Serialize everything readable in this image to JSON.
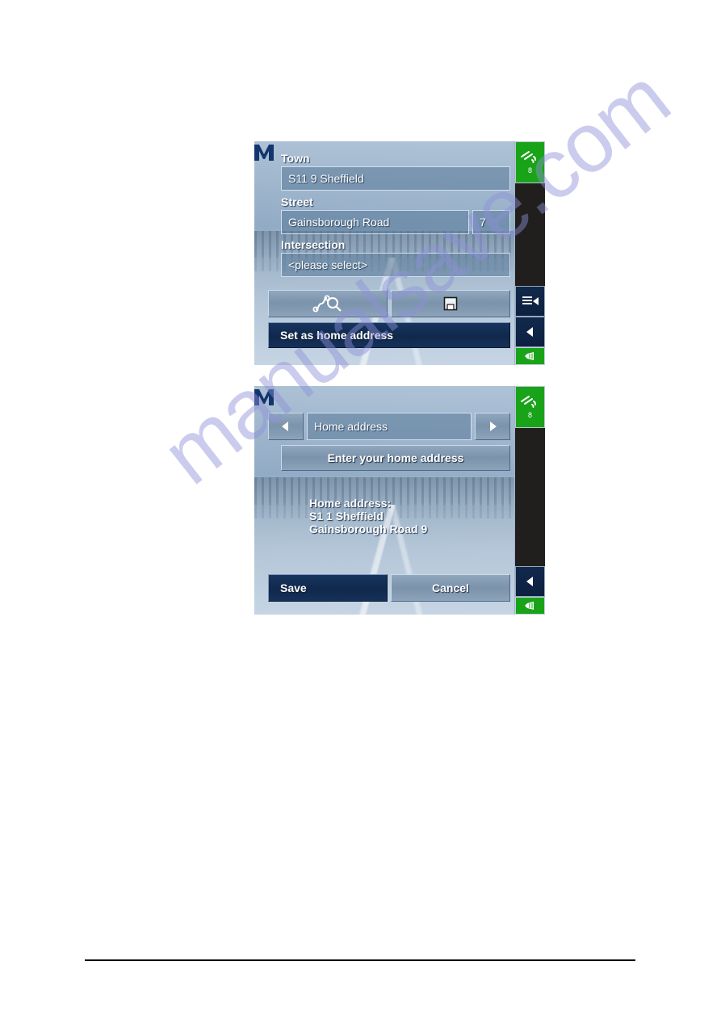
{
  "document": {
    "type": "user-manual-page",
    "watermark": "manualsave.com",
    "footer_rule": true
  },
  "panels": [
    {
      "id": "address-entry",
      "logo_icon": "m-logo-icon",
      "fields": [
        {
          "label": "Town",
          "value": "S11 9 Sheffield",
          "name": "town"
        },
        {
          "label": "Street",
          "value": "Gainsborough Road",
          "name": "street",
          "number": "7"
        },
        {
          "label": "Intersection",
          "value": "<please select>",
          "name": "intersection"
        }
      ],
      "icon_buttons": [
        {
          "icon": "route-search-icon",
          "name": "search-route-button"
        },
        {
          "icon": "floppy-save-icon",
          "name": "save-destination-button"
        }
      ],
      "primary_button": "Set as home address",
      "sidebar": {
        "gps_icon": "satellite-icon",
        "satellite_count": "8",
        "menu_icon": "menu-list-icon",
        "back_icon": "back-arrow-icon",
        "hand_icon": "hand-icon"
      }
    },
    {
      "id": "home-address-settings",
      "logo_icon": "m-logo-icon",
      "nav": {
        "prev_icon": "left-arrow-icon",
        "title": "Home address",
        "next_icon": "right-arrow-icon"
      },
      "action_button": "Enter your home address",
      "info": {
        "heading": "Home address:",
        "line1": "S1 1 Sheffield",
        "line2": "Gainsborough Road 9"
      },
      "buttons": {
        "save": "Save",
        "cancel": "Cancel"
      },
      "sidebar": {
        "gps_icon": "satellite-icon",
        "satellite_count": "8",
        "back_icon": "back-arrow-icon",
        "hand_icon": "hand-icon"
      }
    }
  ],
  "colors": {
    "gps_green": "#19a319",
    "panel_blue": "#7b93ad",
    "dark_button": "#10284b",
    "field_border": "#cfe0ef",
    "watermark": "#8d90d8"
  }
}
